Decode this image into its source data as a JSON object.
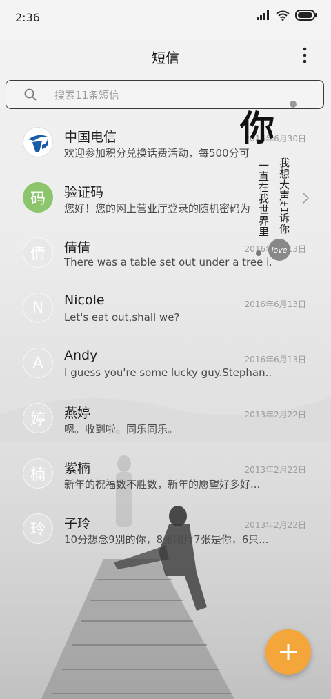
{
  "status_bar": {
    "time": "2:36"
  },
  "header": {
    "title": "短信"
  },
  "search": {
    "placeholder": "搜索11条短信"
  },
  "conversations": [
    {
      "name": "中国电信",
      "date": "2016年6月30日",
      "snippet": "欢迎参加积分兑换话费活动，每500分可",
      "avatar_char": ""
    },
    {
      "name": "验证码",
      "date": "",
      "snippet": "您好！您的网上营业厅登录的随机密码为",
      "avatar_char": "码"
    },
    {
      "name": "倩倩",
      "date": "2016年6月13日",
      "snippet": "There was a table set out under a tree i...",
      "avatar_char": "倩"
    },
    {
      "name": "Nicole",
      "date": "2016年6月13日",
      "snippet": "Let's eat out,shall we?",
      "avatar_char": "N"
    },
    {
      "name": "Andy",
      "date": "2016年6月13日",
      "snippet": "I guess you're some lucky guy.Stephan...",
      "avatar_char": "A"
    },
    {
      "name": "燕婷",
      "date": "2013年2月22日",
      "snippet": "嗯。收到啦。同乐同乐。",
      "avatar_char": "婷"
    },
    {
      "name": "紫楠",
      "date": "2013年2月22日",
      "snippet": "新年的祝福数不胜数，新年的愿望好多好...",
      "avatar_char": "楠"
    },
    {
      "name": "子玲",
      "date": "2013年2月22日",
      "snippet": "10分想念9别的你，8张照片7张是你，6只...",
      "avatar_char": "玲"
    }
  ],
  "wallpaper_text": {
    "big": "你",
    "line1": "我想大声告诉你",
    "line2": "一直在我世界里",
    "tag": "love"
  },
  "colors": {
    "fab": "#f4a63a",
    "verify_avatar": "#8cc56b",
    "telecom_blue": "#1a5ca8"
  },
  "icons": {
    "fab": "plus-icon",
    "search": "search-icon",
    "more": "more-vertical-icon"
  }
}
